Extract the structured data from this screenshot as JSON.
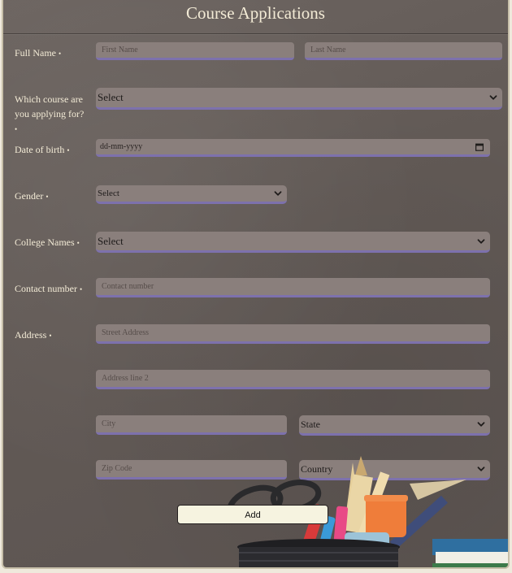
{
  "title": "Course Applications",
  "required_marker": "•",
  "form": {
    "full_name": {
      "label": "Full Name",
      "first_placeholder": "First Name",
      "last_placeholder": "Last Name"
    },
    "course": {
      "label": "Which course are you applying for?",
      "value": "Select"
    },
    "dob": {
      "label": "Date of birth",
      "placeholder": "dd-mm-yyyy"
    },
    "gender": {
      "label": "Gender",
      "value": "Select"
    },
    "college": {
      "label": "College Names",
      "value": "Select"
    },
    "contact": {
      "label": "Contact number",
      "placeholder": "Contact number"
    },
    "address": {
      "label": "Address",
      "street_placeholder": "Street Address",
      "line2_placeholder": "Address line 2",
      "city_placeholder": "City",
      "state_value": "State",
      "zip_placeholder": "Zip Code",
      "country_value": "Country"
    },
    "submit_label": "Add"
  },
  "colors": {
    "background": "#625a56",
    "field_fill": "#8a7f7c",
    "field_underline": "#7d71ad",
    "label_text": "#f3ebd6",
    "button_fill": "#f6f3e0"
  },
  "icons": {
    "select_arrow": "chevron-down-icon",
    "date_picker": "calendar-icon",
    "decoration": "school-supplies-illustration"
  }
}
